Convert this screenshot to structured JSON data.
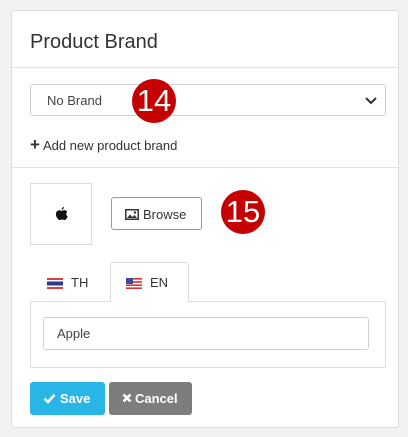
{
  "panel": {
    "title": "Product Brand"
  },
  "brand_select": {
    "value": "No Brand"
  },
  "add_brand_link": {
    "icon": "plus-icon",
    "label": "Add new product brand"
  },
  "step_badges": [
    {
      "number": "14",
      "color": "#c40000"
    },
    {
      "number": "15",
      "color": "#c40000"
    }
  ],
  "logo": {
    "icon": "apple-logo-icon"
  },
  "browse_button": {
    "icon": "image-icon",
    "label": "Browse"
  },
  "tabs": [
    {
      "flag": "thailand-flag-icon",
      "label": "TH",
      "active": false
    },
    {
      "flag": "us-flag-icon",
      "label": "EN",
      "active": true
    }
  ],
  "brand_name_input": {
    "value": "Apple"
  },
  "actions": {
    "save": {
      "icon": "check-icon",
      "label": "Save",
      "color": "#29b6e6"
    },
    "cancel": {
      "icon": "close-icon",
      "label": "Cancel",
      "color": "#7d7d7d"
    }
  }
}
